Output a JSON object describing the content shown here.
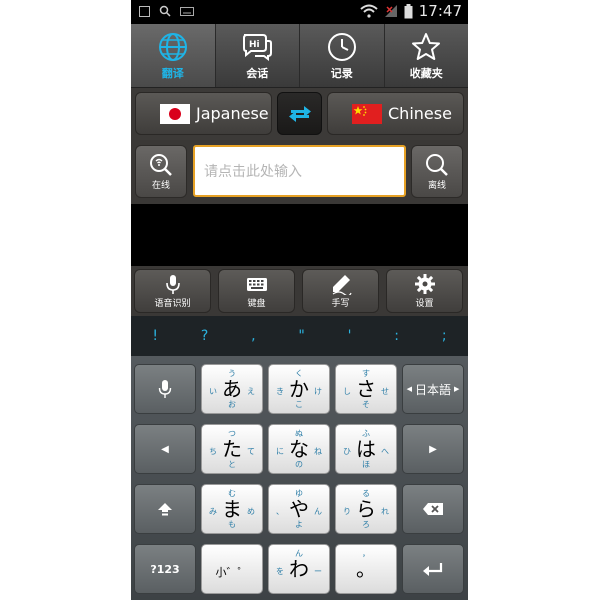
{
  "status_bar": {
    "time": "17:47"
  },
  "nav_tabs": [
    {
      "label": "翻译",
      "icon": "globe-icon",
      "active": true
    },
    {
      "label": "会话",
      "icon": "chat-icon",
      "active": false
    },
    {
      "label": "记录",
      "icon": "clock-icon",
      "active": false
    },
    {
      "label": "收藏夹",
      "icon": "star-icon",
      "active": false
    }
  ],
  "languages": {
    "source": "Japanese",
    "target": "Chinese"
  },
  "search": {
    "placeholder": "请点击此处输入",
    "online_label": "在线",
    "offline_label": "离线"
  },
  "tools": [
    {
      "label": "语音识别",
      "icon": "microphone-icon"
    },
    {
      "label": "键盘",
      "icon": "keyboard-icon"
    },
    {
      "label": "手写",
      "icon": "pen-icon"
    },
    {
      "label": "设置",
      "icon": "gear-icon"
    }
  ],
  "symbols": [
    "!",
    "?",
    ",",
    "\"",
    "'",
    ":",
    ";"
  ],
  "keyboard": {
    "lang_key": "日本語",
    "num_key": "?123",
    "kana": [
      {
        "main": "あ",
        "top": "う",
        "left": "い",
        "right": "え",
        "bottom": "お"
      },
      {
        "main": "か",
        "top": "く",
        "left": "き",
        "right": "け",
        "bottom": "こ"
      },
      {
        "main": "さ",
        "top": "す",
        "left": "し",
        "right": "せ",
        "bottom": "そ"
      },
      {
        "main": "た",
        "top": "つ",
        "left": "ち",
        "right": "て",
        "bottom": "と"
      },
      {
        "main": "な",
        "top": "ぬ",
        "left": "に",
        "right": "ね",
        "bottom": "の"
      },
      {
        "main": "は",
        "top": "ふ",
        "left": "ひ",
        "right": "へ",
        "bottom": "ほ"
      },
      {
        "main": "ま",
        "top": "む",
        "left": "み",
        "right": "め",
        "bottom": "も"
      },
      {
        "main": "や",
        "top": "ゆ",
        "left": "、",
        "right": "ん",
        "bottom": "よ"
      },
      {
        "main": "ら",
        "top": "る",
        "left": "り",
        "right": "れ",
        "bottom": "ろ"
      }
    ],
    "small_key": "小゛゜",
    "wa_key": {
      "main": "わ",
      "top": "ん",
      "left": "を",
      "right": "ー"
    },
    "punct_key": {
      "main": "。",
      "top": "，"
    }
  },
  "colors": {
    "accent": "#1fb4e6",
    "input_border": "#e6a125",
    "flag_jp_red": "#d9001b",
    "flag_cn_red": "#e11f1f"
  }
}
